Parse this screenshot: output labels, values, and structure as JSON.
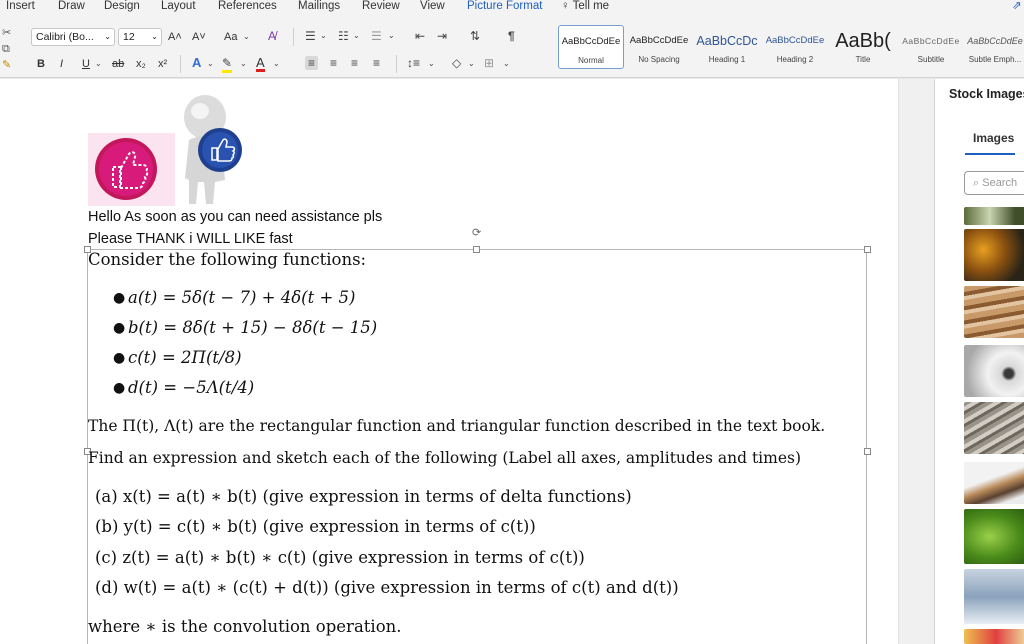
{
  "tabs": [
    {
      "label": "Insert"
    },
    {
      "label": "Draw"
    },
    {
      "label": "Design"
    },
    {
      "label": "Layout"
    },
    {
      "label": "References"
    },
    {
      "label": "Mailings"
    },
    {
      "label": "Review"
    },
    {
      "label": "View"
    },
    {
      "label": "Picture Format"
    }
  ],
  "tell_me": "Tell me",
  "ribbon": {
    "font_name": "Calibri (Bo...",
    "font_size": "12",
    "grow_font": "A˄",
    "shrink_font": "A˅",
    "change_case": "Aa",
    "bold": "B",
    "italic": "I",
    "underline": "U",
    "strike": "ab",
    "subscript": "x₂",
    "superscript": "x²",
    "text_effects": "A",
    "font_color": "A"
  },
  "styles": [
    {
      "preview": "AaBbCcDdEe",
      "name": "Normal"
    },
    {
      "preview": "AaBbCcDdEe",
      "name": "No Spacing"
    },
    {
      "preview": "AaBbCcDc",
      "name": "Heading 1"
    },
    {
      "preview": "AaBbCcDdEe",
      "name": "Heading 2"
    },
    {
      "preview": "AaBb(",
      "name": "Title"
    },
    {
      "preview": "AaBbCcDdEe",
      "name": "Subtitle"
    },
    {
      "preview": "AaBbCcDdEe",
      "name": "Subtle Emph..."
    }
  ],
  "pane": {
    "title": "Stock Images",
    "tab": "Images",
    "search_placeholder": "Search"
  },
  "doc": {
    "line1": "Hello As soon as you can need assistance pls",
    "line2": "Please THANK i WILL LIKE fast",
    "intro": "Consider the following functions:",
    "bullets": [
      "a(t) = 5δ(t − 7) + 4δ(t + 5)",
      "b(t) = 8δ(t + 15) − 8δ(t − 15)",
      "c(t) = 2Π(t/8)",
      "d(t) = −5Λ(t/4)"
    ],
    "para1": "The Π(t), Λ(t) are the rectangular function and triangular function described in the text book.",
    "para2": "Find an expression and sketch each of the following (Label all axes, amplitudes and times)",
    "items": [
      "(a)  x(t) = a(t) ∗ b(t) (give expression in terms of delta functions)",
      "(b)  y(t) = c(t) ∗ b(t) (give expression in terms of c(t))",
      "(c)  z(t) = a(t) ∗ b(t) ∗ c(t) (give expression in terms of c(t))",
      "(d)  w(t) = a(t) ∗ (c(t) + d(t)) (give expression in terms of c(t) and d(t))"
    ],
    "closing": "where ∗ is the convolution operation."
  },
  "colors": {
    "accent": "#1f5fbf",
    "like_pink": "#c2185b",
    "like_blue": "#1f3f8f"
  }
}
